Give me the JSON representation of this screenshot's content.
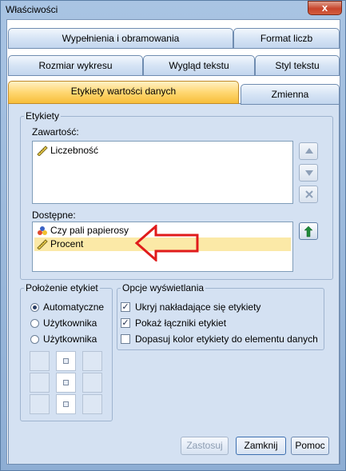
{
  "window": {
    "title": "Właściwości",
    "close": "x"
  },
  "tabs": {
    "row1": [
      {
        "label": "Wypełnienia i obramowania"
      },
      {
        "label": "Format liczb"
      }
    ],
    "row2": [
      {
        "label": "Rozmiar wykresu"
      },
      {
        "label": "Wygląd tekstu"
      },
      {
        "label": "Styl tekstu"
      }
    ],
    "row3": [
      {
        "label": "Etykiety wartości danych",
        "active": true
      },
      {
        "label": "Zmienna"
      }
    ]
  },
  "etykiety": {
    "legend": "Etykiety",
    "contents_label": "Zawartość:",
    "contents": [
      {
        "label": "Liczebność",
        "icon": "ruler-icon"
      }
    ],
    "available_label": "Dostępne:",
    "available": [
      {
        "label": "Czy pali papierosy",
        "icon": "nominal-icon"
      },
      {
        "label": "Procent",
        "icon": "ruler-icon",
        "selected": true
      }
    ]
  },
  "position": {
    "legend": "Położenie etykiet",
    "options": [
      {
        "label": "Automatyczne",
        "checked": true
      },
      {
        "label": "Użytkownika",
        "checked": false
      },
      {
        "label": "Użytkownika",
        "checked": false
      }
    ]
  },
  "display": {
    "legend": "Opcje wyświetlania",
    "options": [
      {
        "label": "Ukryj nakładające się etykiety",
        "checked": true
      },
      {
        "label": "Pokaż łączniki etykiet",
        "checked": true
      },
      {
        "label": "Dopasuj kolor etykiety do elementu danych",
        "checked": false
      }
    ]
  },
  "buttons": {
    "apply": "Zastosuj",
    "close": "Zamknij",
    "help": "Pomoc"
  },
  "colors": {
    "selected": "#fbe9a7",
    "active_tab": "#ffd772",
    "annotation_arrow": "#e01b1b"
  }
}
